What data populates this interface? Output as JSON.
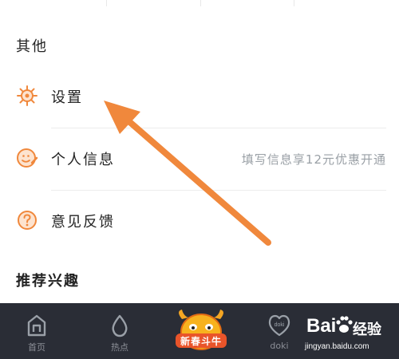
{
  "sections": {
    "other_title": "其他",
    "recommend_title": "推荐兴趣"
  },
  "menu": [
    {
      "label": "设置",
      "icon": "gear-icon"
    },
    {
      "label": "个人信息",
      "icon": "profile-icon",
      "hint": "填写信息享12元优惠开通"
    },
    {
      "label": "意见反馈",
      "icon": "question-icon"
    }
  ],
  "bottom_nav": [
    {
      "label": "首页",
      "icon": "home-icon"
    },
    {
      "label": "热点",
      "icon": "flame-drop-icon"
    },
    {
      "label": "新春斗牛",
      "icon": "bull-mascot-icon"
    },
    {
      "label": "doki",
      "icon": "doki-heart-icon"
    }
  ],
  "watermark": {
    "logo": "Bai",
    "text": "经验",
    "url": "jingyan.baidu.com"
  },
  "colors": {
    "accent_orange": "#f0883c",
    "nav_bg": "#2a2d36",
    "hint_gray": "#9aa0a6"
  }
}
